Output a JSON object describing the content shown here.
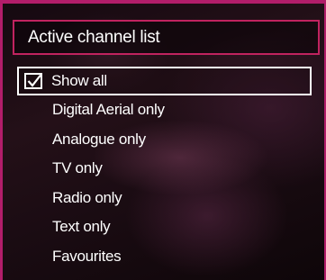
{
  "accent_color": "#b21d6a",
  "title": "Active channel list",
  "items": [
    {
      "label": "Show all",
      "selected": true,
      "checked": true,
      "icon": "checkmark-icon"
    },
    {
      "label": "Digital Aerial only"
    },
    {
      "label": "Analogue only"
    },
    {
      "label": "TV only"
    },
    {
      "label": "Radio only"
    },
    {
      "label": "Text only"
    },
    {
      "label": "Favourites"
    }
  ]
}
